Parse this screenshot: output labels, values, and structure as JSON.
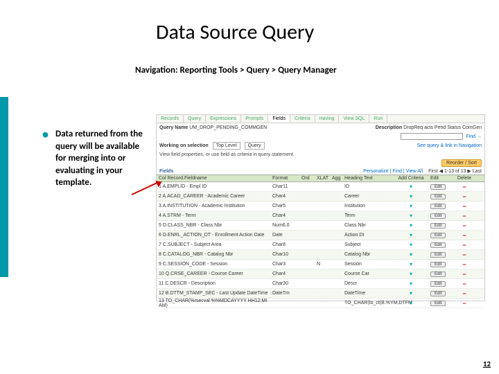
{
  "title": "Data Source Query",
  "subtitle": "Navigation: Reporting Tools > Query > Query Manager",
  "body": "Data returned from the query will be available for merging into or evaluating in your template.",
  "page_number": "12",
  "panel": {
    "tabs": [
      "Records",
      "Query",
      "Expressions",
      "Prompts",
      "Fields",
      "Criteria",
      "Having",
      "View SQL",
      "Run"
    ],
    "active_tab": "Fields",
    "query_name_label": "Query Name",
    "query_name": "UM_DROP_PENDING_COMMGEN",
    "desc_label": "Description",
    "desc": "DropReq acts Pend Status ComGen",
    "find_label": "Find →",
    "working_label": "Working on selection",
    "working_top": "Top Level",
    "working_q": "Query",
    "find_link": "See query & link in Navigation",
    "fields_hdr": "Fields",
    "instr": "View field properties, or use field as criteria in query statement.",
    "reorder": "Reorder / Sort",
    "personal": "Personalize | Find | View All",
    "range": "First ◀ 1-13 of 13 ▶ Last",
    "cols": {
      "c1": "Col  Record.Fieldname",
      "c2": "Format",
      "c3": "Ord",
      "c4": "XLAT",
      "c4b": "Agg",
      "c5": "Heading Text",
      "c6": "Add Criteria",
      "c7": "Edit",
      "c8": "Delete"
    },
    "rows": [
      {
        "n": "1",
        "f": "A.EMPLID - Empl ID",
        "fmt": "Char11",
        "h": "ID"
      },
      {
        "n": "2",
        "f": "A.ACAD_CAREER - Academic Career",
        "fmt": "Char4",
        "h": "Career"
      },
      {
        "n": "3",
        "f": "A.INSTITUTION - Academic Institution",
        "fmt": "Char5",
        "h": "Institution"
      },
      {
        "n": "4",
        "f": "A.STRM - Term",
        "fmt": "Char4",
        "h": "Term"
      },
      {
        "n": "5",
        "f": "D.CLASS_NBR - Class Nbr",
        "fmt": "Num6.0",
        "h": "Class Nbr"
      },
      {
        "n": "6",
        "f": "D.ENRL_ACTION_DT - Enrollment Action Date",
        "fmt": "Date",
        "h": "Action Dt"
      },
      {
        "n": "7",
        "f": "C.SUBJECT - Subject Area",
        "fmt": "Char8",
        "h": "Subject"
      },
      {
        "n": "8",
        "f": "C.CATALOG_NBR - Catalog Nbr",
        "fmt": "Char10",
        "h": "Catalog Nbr"
      },
      {
        "n": "9",
        "f": "C.SESSION_CODE - Session",
        "fmt": "Char3",
        "h": "Session",
        "x": "N"
      },
      {
        "n": "10",
        "f": "Q.CRSE_CAREER - Course Career",
        "fmt": "Char4",
        "h": "Course Car"
      },
      {
        "n": "11",
        "f": "C.DESCR - Description",
        "fmt": "Char30",
        "h": "Descr"
      },
      {
        "n": "12",
        "f": "B.DTTM_STAMP_SEC - Last Update DateTime",
        "fmt": "DateTm",
        "h": "DateTime"
      },
      {
        "n": "13",
        "f": "TO_CHAR(%rsecval %%MDCAYYYY HH12:MI AM)",
        "fmt": "",
        "h": "TO_CHAR(to_ct(B.%YM,DTFM"
      }
    ],
    "edit": "Edit"
  }
}
